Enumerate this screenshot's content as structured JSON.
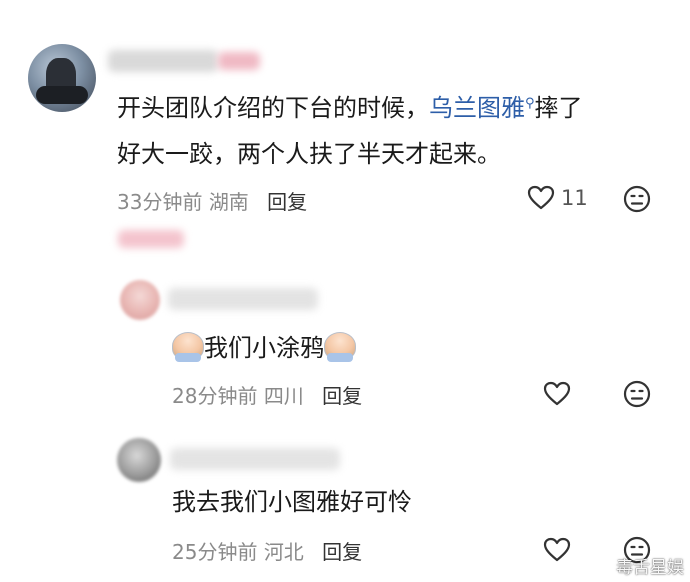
{
  "comments": [
    {
      "text_line1_pre": "开头团队介绍的下台的时候，",
      "mention": "乌兰图雅",
      "text_line1_post": "摔了",
      "text_line2": "好大一跤，两个人扶了半天才起来。",
      "time": "33分钟前",
      "location": "湖南",
      "reply_label": "回复",
      "like_count": "11"
    }
  ],
  "replies": [
    {
      "text": "我们小涂鸦",
      "time": "28分钟前",
      "location": "四川",
      "reply_label": "回复"
    },
    {
      "text": "我去我们小图雅好可怜",
      "time": "25分钟前",
      "location": "河北",
      "reply_label": "回复"
    }
  ],
  "watermark": {
    "text": "毒舌星娱"
  },
  "icons": {
    "like": "heart-outline-icon",
    "dislike": "meh-face-icon",
    "mention": "search-icon"
  },
  "colors": {
    "mention": "#2d5ea8",
    "meta": "#8a8a8a"
  }
}
